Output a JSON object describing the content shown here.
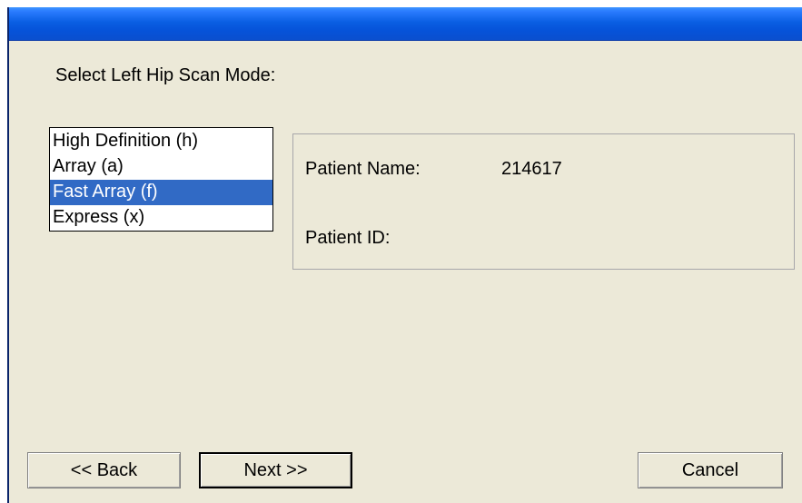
{
  "dialog": {
    "prompt": "Select Left Hip Scan Mode:"
  },
  "scan_modes": {
    "items": [
      {
        "label": "High Definition (h)",
        "selected": false
      },
      {
        "label": "Array (a)",
        "selected": false
      },
      {
        "label": "Fast Array (f)",
        "selected": true
      },
      {
        "label": "Express (x)",
        "selected": false
      }
    ]
  },
  "patient": {
    "name_label": "Patient Name:",
    "name_value": "214617",
    "id_label": "Patient ID:",
    "id_value": ""
  },
  "buttons": {
    "back": "<< Back",
    "next": "Next >>",
    "cancel": "Cancel"
  },
  "colors": {
    "titlebar": "#0a5fe3",
    "dialog_bg": "#ece9d8",
    "selection": "#316ac5"
  }
}
